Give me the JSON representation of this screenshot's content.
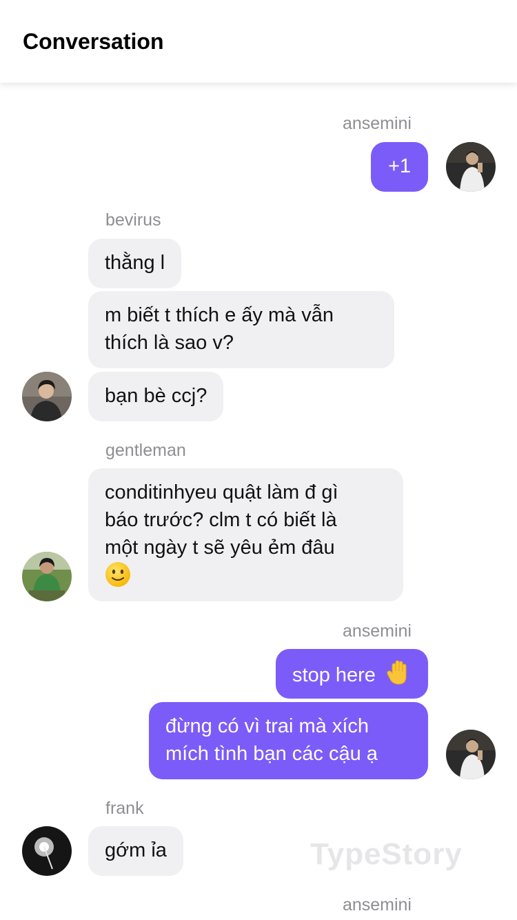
{
  "header": {
    "title": "Conversation"
  },
  "messages": [
    {
      "sender": "ansemini",
      "side": "right",
      "bubbles": [
        "+1"
      ]
    },
    {
      "sender": "bevirus",
      "side": "left",
      "bubbles": [
        "thằng l",
        "m biết t thích e ấy mà vẫn",
        "thích là sao v?",
        "bạn bè ccj?"
      ]
    },
    {
      "sender": "gentleman",
      "side": "left",
      "bubbles": [
        "conditinhyeu quật làm đ gì",
        "báo trước? clm t có biết là",
        "một ngày t sẽ yêu ẻm đâu"
      ]
    },
    {
      "sender": "ansemini",
      "side": "right",
      "bubbles": [
        "stop here",
        "đừng có vì trai mà xích",
        "mích tình bạn các cậu ạ"
      ]
    },
    {
      "sender": "frank",
      "side": "left",
      "bubbles": [
        "gớm ỉa"
      ]
    },
    {
      "sender": "ansemini",
      "side": "right",
      "bubbles": []
    }
  ],
  "emojis": {
    "smile": "slightly-smiling-face",
    "hand": "raised-hand"
  },
  "watermark": "TypeStory",
  "colors": {
    "outgoing": "#7b5cf8",
    "incoming": "#f0f0f2",
    "sender_label": "#8e8e93"
  }
}
